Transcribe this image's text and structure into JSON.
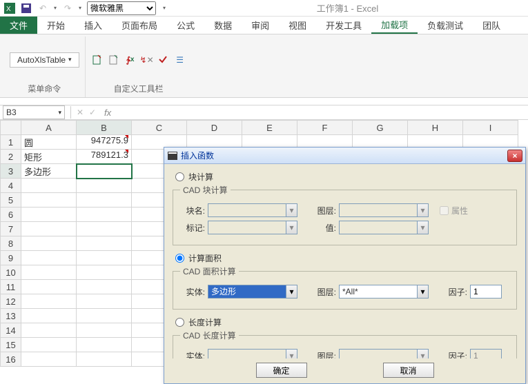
{
  "app": {
    "title": "工作簿1 - Excel"
  },
  "qat": {
    "font_value": "微软雅黑"
  },
  "tabs": {
    "file": "文件",
    "items": [
      "开始",
      "插入",
      "页面布局",
      "公式",
      "数据",
      "审阅",
      "视图",
      "开发工具",
      "加载项",
      "负载测试",
      "团队"
    ],
    "active_index": 8
  },
  "ribbon": {
    "autoxls_label": "AutoXlsTable",
    "group1": "菜单命令",
    "group2": "自定义工具栏"
  },
  "formula": {
    "name_box": "B3",
    "fx": "fx",
    "value": ""
  },
  "grid": {
    "cols": [
      "A",
      "B",
      "C",
      "D",
      "E",
      "F",
      "G",
      "H",
      "I"
    ],
    "rows": [
      {
        "n": "1",
        "a": "圆",
        "b": "947275.9",
        "b_tick": true
      },
      {
        "n": "2",
        "a": "矩形",
        "b": "789121.3",
        "b_tick": true
      },
      {
        "n": "3",
        "a": "多边形",
        "b": "",
        "active": true
      },
      {
        "n": "4"
      },
      {
        "n": "5"
      },
      {
        "n": "6"
      },
      {
        "n": "7"
      },
      {
        "n": "8"
      },
      {
        "n": "9"
      },
      {
        "n": "10"
      },
      {
        "n": "11"
      },
      {
        "n": "12"
      },
      {
        "n": "13"
      },
      {
        "n": "14"
      },
      {
        "n": "15"
      },
      {
        "n": "16"
      }
    ]
  },
  "dialog": {
    "title": "插入函数",
    "close": "×",
    "radio_block": "块计算",
    "group_block": "CAD 块计算",
    "block_name_lbl": "块名:",
    "layer_lbl": "图层:",
    "mark_lbl": "标记:",
    "value_lbl": "值:",
    "attr_chk": "属性",
    "radio_area": "计算面积",
    "group_area": "CAD 面积计算",
    "entity_lbl": "实体:",
    "entity_val": "多边形",
    "layer_area_val": "*All*",
    "factor_lbl": "因子:",
    "factor_area_val": "1",
    "radio_len": "长度计算",
    "group_len": "CAD 长度计算",
    "factor_len_val": "1",
    "ok": "确定",
    "cancel": "取消"
  }
}
